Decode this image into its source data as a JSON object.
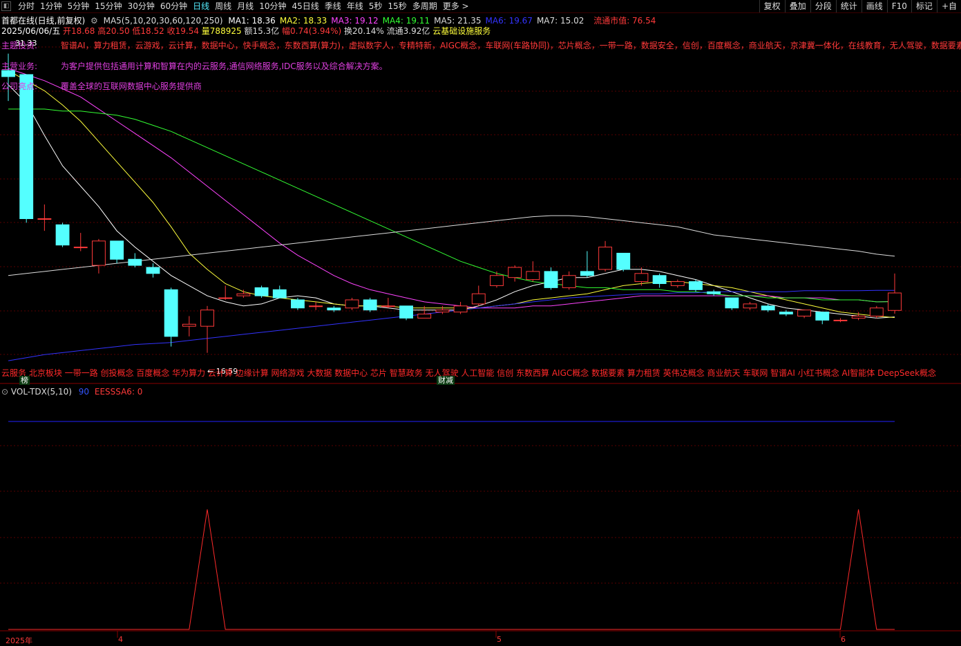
{
  "toolbar": {
    "tabs": [
      "分时",
      "1分钟",
      "5分钟",
      "15分钟",
      "30分钟",
      "60分钟",
      "日线",
      "周线",
      "月线",
      "10分钟",
      "45日线",
      "季线",
      "年线",
      "5秒",
      "15秒",
      "多周期",
      "更多 >"
    ],
    "active_tab": "日线",
    "right_tools": [
      "复权",
      "叠加",
      "分段",
      "统计",
      "画线",
      "F10",
      "标记",
      "+自"
    ]
  },
  "header": {
    "stock_title": "首都在线(日线,前复权)",
    "ma_label": "MA5(5,10,20,30,60,120,250)",
    "ma_values": [
      {
        "label": "MA1: 18.36",
        "color": "#ffffff"
      },
      {
        "label": "MA2: 18.33",
        "color": "#ffff3c"
      },
      {
        "label": "MA3: 19.12",
        "color": "#ff44ff"
      },
      {
        "label": "MA4: 19.11",
        "color": "#33ff33"
      },
      {
        "label": "MA5: 21.35",
        "color": "#dddddd"
      },
      {
        "label": "MA6: 19.67",
        "color": "#3333ff"
      },
      {
        "label": "MA7: 15.02",
        "color": "#dddddd"
      }
    ],
    "float_mkt_cap": "流通市值: 76.54",
    "date": "2025/06/06/五",
    "open": "开18.68",
    "high": "高20.50",
    "low": "低18.52",
    "close": "收19.54",
    "volume": "量788925",
    "amount": "额15.3亿",
    "change": "幅0.74(3.94%)",
    "turnover": "换20.14%",
    "float_shares": "流通3.92亿",
    "industry": "云基础设施服务"
  },
  "info": {
    "concepts_label": "主题投资:",
    "concepts": "智谱AI，算力租赁，云游戏，云计算，数据中心，快手概念，东数西算(算力)，虚拟数字人，专精特新，AIGC概念，车联网(车路协同)，芯片概念，一带一路，数据安全，信创，百度概念，商业航天，京津冀一体化，在线教育，无人驾驶，数据要素",
    "business_label": "主营业务:",
    "business": "为客户提供包括通用计算和智算在内的云服务,通信网络服务,IDC服务以及综合解决方案。",
    "profile_label": "公司亮点:",
    "profile": "覆盖全球的互联网数据中心服务提供商",
    "high_marker": "31.33",
    "low_marker": "← 16.59"
  },
  "bottom_concepts": "云服务 北京板块 一带一路 创投概念 百度概念 华为算力 云计算 边缘计算 网络游戏 大数据 数据中心 芯片 智慧政务 无人驾驶 人工智能 信创 东数西算 AIGC概念 数据要素 算力租赁 英伟达概念 商业航天 车联网 智谱AI 小红书概念 AI智能体 DeepSeek概念",
  "badges": {
    "list": "榜",
    "finance": "财减"
  },
  "volume_panel": {
    "title": "VOL-TDX(5,10)",
    "v1": "90",
    "v2": "EESSSA6: 0"
  },
  "x_axis": [
    {
      "label": "2025年"
    },
    {
      "label": "4"
    },
    {
      "label": "5"
    },
    {
      "label": "6"
    }
  ],
  "chart_data": {
    "type": "candlestick",
    "ylim": [
      16.0,
      32.0
    ],
    "candles": [
      {
        "o": 30.5,
        "c": 30.2,
        "h": 31.33,
        "l": 29.0
      },
      {
        "o": 30.3,
        "c": 23.2,
        "h": 30.3,
        "l": 23.0
      },
      {
        "o": 23.2,
        "c": 23.2,
        "h": 23.9,
        "l": 22.6
      },
      {
        "o": 22.9,
        "c": 21.9,
        "h": 23.0,
        "l": 21.8
      },
      {
        "o": 21.8,
        "c": 21.8,
        "h": 22.5,
        "l": 21.6
      },
      {
        "o": 20.9,
        "c": 22.1,
        "h": 22.2,
        "l": 20.5
      },
      {
        "o": 22.1,
        "c": 21.2,
        "h": 22.1,
        "l": 21.0
      },
      {
        "o": 21.2,
        "c": 20.9,
        "h": 21.5,
        "l": 20.8
      },
      {
        "o": 20.8,
        "c": 20.5,
        "h": 21.0,
        "l": 20.3
      },
      {
        "o": 19.7,
        "c": 17.4,
        "h": 19.8,
        "l": 16.9
      },
      {
        "o": 17.9,
        "c": 18.0,
        "h": 18.4,
        "l": 17.4
      },
      {
        "o": 17.9,
        "c": 18.7,
        "h": 18.9,
        "l": 16.59
      },
      {
        "o": 19.3,
        "c": 19.3,
        "h": 19.9,
        "l": 19.2
      },
      {
        "o": 19.4,
        "c": 19.5,
        "h": 19.7,
        "l": 19.3
      },
      {
        "o": 19.8,
        "c": 19.4,
        "h": 19.9,
        "l": 19.3
      },
      {
        "o": 19.7,
        "c": 19.3,
        "h": 19.9,
        "l": 19.3
      },
      {
        "o": 19.2,
        "c": 18.8,
        "h": 19.3,
        "l": 18.7
      },
      {
        "o": 18.9,
        "c": 18.9,
        "h": 19.1,
        "l": 18.7
      },
      {
        "o": 18.8,
        "c": 18.7,
        "h": 18.9,
        "l": 18.6
      },
      {
        "o": 18.8,
        "c": 19.2,
        "h": 19.3,
        "l": 18.7
      },
      {
        "o": 19.2,
        "c": 18.7,
        "h": 19.3,
        "l": 18.6
      },
      {
        "o": 18.9,
        "c": 18.9,
        "h": 19.3,
        "l": 18.8
      },
      {
        "o": 18.9,
        "c": 18.3,
        "h": 18.9,
        "l": 18.2
      },
      {
        "o": 18.3,
        "c": 18.5,
        "h": 18.9,
        "l": 18.3
      },
      {
        "o": 18.6,
        "c": 18.7,
        "h": 18.9,
        "l": 18.5
      },
      {
        "o": 18.6,
        "c": 18.9,
        "h": 19.1,
        "l": 18.5
      },
      {
        "o": 19.0,
        "c": 19.5,
        "h": 19.9,
        "l": 18.9
      },
      {
        "o": 19.9,
        "c": 20.4,
        "h": 20.6,
        "l": 19.8
      },
      {
        "o": 20.3,
        "c": 20.8,
        "h": 20.9,
        "l": 20.1
      },
      {
        "o": 20.2,
        "c": 20.6,
        "h": 21.1,
        "l": 20.1
      },
      {
        "o": 20.6,
        "c": 19.8,
        "h": 20.8,
        "l": 19.7
      },
      {
        "o": 19.8,
        "c": 20.4,
        "h": 20.6,
        "l": 19.7
      },
      {
        "o": 20.6,
        "c": 20.4,
        "h": 21.6,
        "l": 20.3
      },
      {
        "o": 20.7,
        "c": 21.8,
        "h": 22.1,
        "l": 20.6
      },
      {
        "o": 21.5,
        "c": 20.7,
        "h": 21.5,
        "l": 20.6
      },
      {
        "o": 20.1,
        "c": 20.5,
        "h": 20.8,
        "l": 19.9
      },
      {
        "o": 20.4,
        "c": 20.0,
        "h": 20.5,
        "l": 19.8
      },
      {
        "o": 19.9,
        "c": 20.1,
        "h": 20.2,
        "l": 19.8
      },
      {
        "o": 20.1,
        "c": 19.7,
        "h": 20.2,
        "l": 19.6
      },
      {
        "o": 19.6,
        "c": 19.5,
        "h": 19.7,
        "l": 19.4
      },
      {
        "o": 19.3,
        "c": 18.8,
        "h": 19.3,
        "l": 18.7
      },
      {
        "o": 18.8,
        "c": 19.0,
        "h": 19.1,
        "l": 18.7
      },
      {
        "o": 18.9,
        "c": 18.7,
        "h": 19.0,
        "l": 18.6
      },
      {
        "o": 18.6,
        "c": 18.5,
        "h": 18.7,
        "l": 18.4
      },
      {
        "o": 18.4,
        "c": 18.7,
        "h": 18.7,
        "l": 18.3
      },
      {
        "o": 18.6,
        "c": 18.2,
        "h": 18.6,
        "l": 18.0
      },
      {
        "o": 18.2,
        "c": 18.2,
        "h": 18.3,
        "l": 18.1
      },
      {
        "o": 18.3,
        "c": 18.4,
        "h": 18.6,
        "l": 18.2
      },
      {
        "o": 18.4,
        "c": 18.8,
        "h": 18.9,
        "l": 18.3
      },
      {
        "o": 18.68,
        "c": 19.54,
        "h": 20.5,
        "l": 18.52
      }
    ],
    "ma_lines": [
      {
        "name": "MA1",
        "color": "#ffffff",
        "values": [
          29.8,
          28.9,
          27.3,
          25.8,
          24.8,
          23.8,
          22.6,
          21.8,
          21.1,
          20.4,
          19.9,
          19.4,
          19.1,
          18.9,
          19.0,
          19.3,
          19.4,
          19.3,
          19.0,
          18.9,
          18.9,
          18.8,
          18.7,
          18.7,
          18.7,
          18.7,
          18.9,
          19.2,
          19.6,
          19.9,
          20.1,
          20.3,
          20.3,
          20.5,
          20.7,
          20.7,
          20.6,
          20.4,
          20.2,
          19.9,
          19.6,
          19.3,
          19.0,
          18.8,
          18.7,
          18.6,
          18.5,
          18.4,
          18.3,
          18.36
        ]
      },
      {
        "name": "MA2",
        "color": "#ffff3c",
        "values": [
          30.5,
          30.0,
          29.5,
          28.8,
          28.0,
          27.0,
          26.0,
          25.0,
          24.0,
          22.8,
          21.5,
          20.7,
          20.0,
          19.6,
          19.4,
          19.3,
          19.2,
          19.1,
          19.0,
          18.9,
          18.9,
          18.9,
          18.8,
          18.8,
          18.8,
          18.8,
          18.8,
          18.9,
          19.0,
          19.2,
          19.3,
          19.4,
          19.5,
          19.7,
          19.9,
          20.0,
          20.1,
          20.1,
          20.0,
          19.9,
          19.8,
          19.6,
          19.4,
          19.2,
          19.0,
          18.8,
          18.6,
          18.5,
          18.4,
          18.33
        ]
      },
      {
        "name": "MA3",
        "color": "#ff44ff",
        "values": [
          30.6,
          30.3,
          30.0,
          29.6,
          29.2,
          28.6,
          28.0,
          27.4,
          26.8,
          26.2,
          25.5,
          24.8,
          24.1,
          23.4,
          22.7,
          22.0,
          21.4,
          20.9,
          20.4,
          20.0,
          19.7,
          19.5,
          19.3,
          19.1,
          19.0,
          18.9,
          18.8,
          18.8,
          18.8,
          18.9,
          18.9,
          19.0,
          19.1,
          19.2,
          19.3,
          19.4,
          19.4,
          19.4,
          19.4,
          19.4,
          19.4,
          19.4,
          19.4,
          19.3,
          19.3,
          19.3,
          19.2,
          19.2,
          19.1,
          19.12
        ]
      },
      {
        "name": "MA4",
        "color": "#33ff33",
        "values": [
          28.6,
          28.6,
          28.6,
          28.5,
          28.5,
          28.4,
          28.3,
          28.1,
          27.8,
          27.5,
          27.1,
          26.7,
          26.3,
          25.9,
          25.5,
          25.1,
          24.7,
          24.3,
          23.9,
          23.5,
          23.1,
          22.7,
          22.3,
          21.9,
          21.5,
          21.1,
          20.8,
          20.5,
          20.3,
          20.1,
          20.0,
          19.9,
          19.8,
          19.8,
          19.7,
          19.7,
          19.7,
          19.6,
          19.6,
          19.5,
          19.4,
          19.4,
          19.3,
          19.3,
          19.3,
          19.2,
          19.2,
          19.2,
          19.1,
          19.11
        ]
      },
      {
        "name": "MA5",
        "color": "#dddddd",
        "values": [
          20.4,
          20.5,
          20.6,
          20.7,
          20.8,
          20.9,
          21.0,
          21.1,
          21.2,
          21.3,
          21.4,
          21.5,
          21.6,
          21.7,
          21.8,
          21.9,
          22.0,
          22.1,
          22.2,
          22.3,
          22.4,
          22.5,
          22.6,
          22.7,
          22.8,
          22.9,
          23.0,
          23.1,
          23.2,
          23.3,
          23.35,
          23.35,
          23.3,
          23.2,
          23.1,
          23.0,
          22.9,
          22.8,
          22.6,
          22.4,
          22.3,
          22.2,
          22.1,
          22.0,
          21.9,
          21.8,
          21.7,
          21.6,
          21.45,
          21.35
        ]
      },
      {
        "name": "MA6",
        "color": "#3333ff",
        "values": [
          16.2,
          16.35,
          16.5,
          16.6,
          16.7,
          16.8,
          16.9,
          17.0,
          17.05,
          17.1,
          17.2,
          17.3,
          17.4,
          17.5,
          17.6,
          17.7,
          17.8,
          17.9,
          18.0,
          18.1,
          18.2,
          18.3,
          18.4,
          18.5,
          18.6,
          18.7,
          18.8,
          18.9,
          19.0,
          19.1,
          19.2,
          19.3,
          19.35,
          19.4,
          19.45,
          19.5,
          19.5,
          19.55,
          19.55,
          19.6,
          19.6,
          19.6,
          19.6,
          19.6,
          19.65,
          19.65,
          19.65,
          19.65,
          19.67,
          19.67
        ]
      }
    ],
    "volume_signal": {
      "baseline": 0,
      "level": 90,
      "spikes_at": [
        11,
        47
      ],
      "spike_value": 90
    }
  }
}
